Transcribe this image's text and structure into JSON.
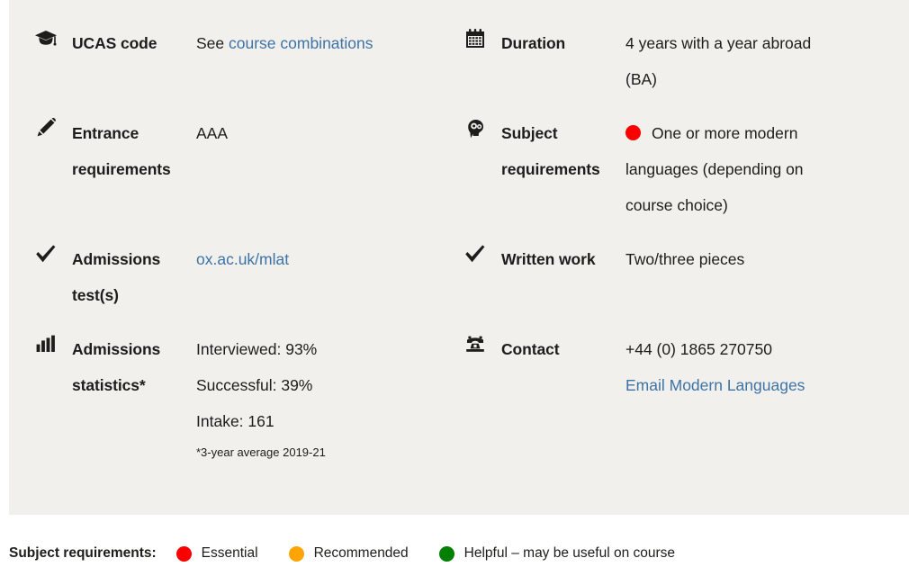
{
  "card": {
    "background_color": "#f1f0ec",
    "link_color": "#3e73a8"
  },
  "facts": [
    {
      "id": "ucas-code",
      "icon": "graduation-cap-icon",
      "label": "UCAS code",
      "value_prefix": "See ",
      "link_text": "course combinations"
    },
    {
      "id": "duration",
      "icon": "calendar-icon",
      "label": "Duration",
      "lines": [
        "4 years with a year abroad",
        "(BA)"
      ]
    },
    {
      "id": "entrance-requirements",
      "icon": "pencil-icon",
      "label": "Entrance requirements",
      "lines": [
        "AAA"
      ]
    },
    {
      "id": "subject-requirements",
      "icon": "head-cogs-icon",
      "label": "Subject requirements",
      "dot_color": "#fa0000",
      "lines": [
        "One or more modern",
        "languages (depending on",
        "course choice)"
      ]
    },
    {
      "id": "admissions-tests",
      "icon": "check-icon",
      "label": "Admissions test(s)",
      "link_text": "ox.ac.uk/mlat"
    },
    {
      "id": "written-work",
      "icon": "check-icon",
      "label": "Written work",
      "lines": [
        "Two/three pieces"
      ]
    },
    {
      "id": "admissions-statistics",
      "icon": "bar-chart-icon",
      "label": "Admissions statistics*",
      "lines": [
        "Interviewed: 93%",
        "Successful: 39%",
        "Intake: 161"
      ],
      "footnote": "*3-year average 2019-21"
    },
    {
      "id": "contact",
      "icon": "telephone-icon",
      "label": "Contact",
      "lines": [
        "+44 (0) 1865 270750"
      ],
      "link_text": "Email Modern Languages"
    }
  ],
  "legend": {
    "title": "Subject requirements:",
    "items": [
      {
        "color": "#fa0000",
        "label": "Essential"
      },
      {
        "color": "#ffa400",
        "label": "Recommended"
      },
      {
        "color": "#008000",
        "label": "Helpful – may be useful on course"
      }
    ]
  }
}
